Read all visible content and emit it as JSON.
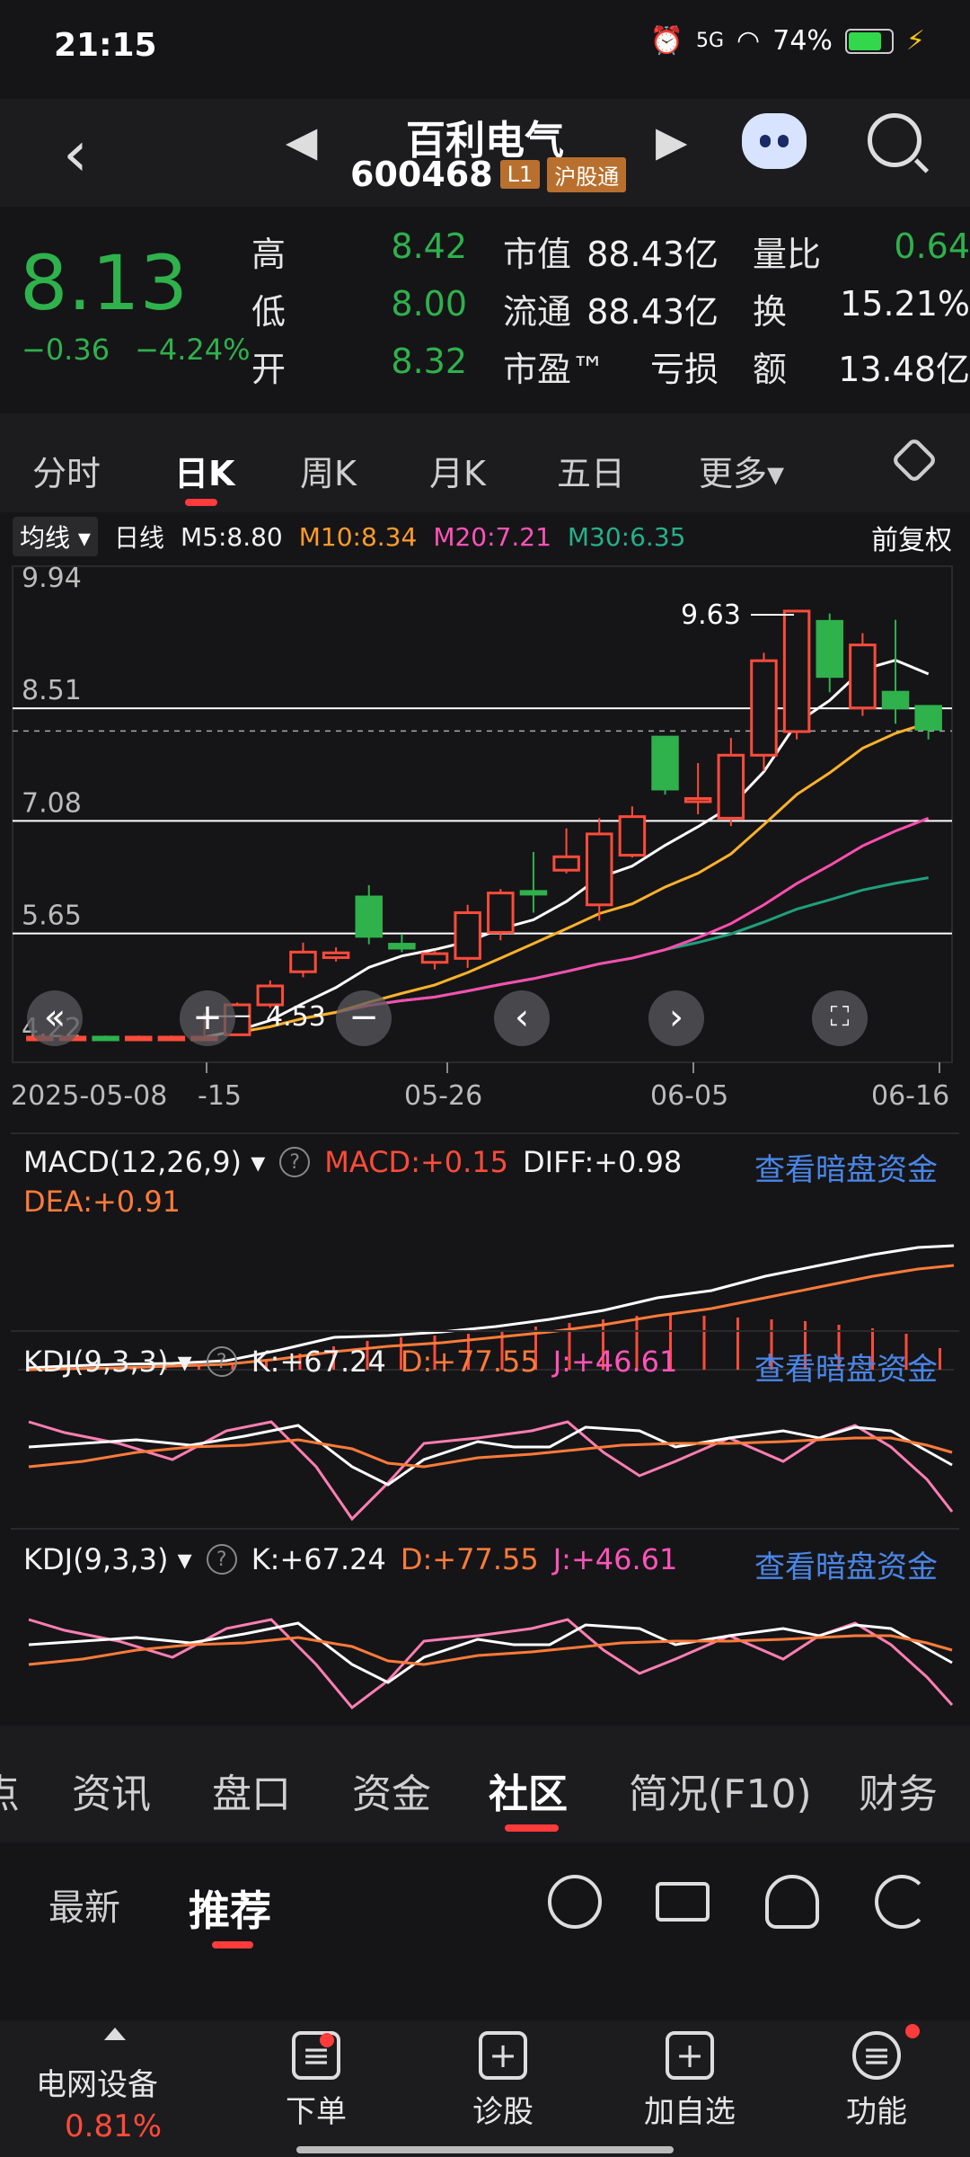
{
  "status": {
    "time": "21:15",
    "network": "5G",
    "battery": "74%"
  },
  "header": {
    "name": "百利电气",
    "code": "600468",
    "tag_level": "L1",
    "tag_connect": "沪股通"
  },
  "quote": {
    "price": "8.13",
    "change": "−0.36",
    "change_pct": "−4.24%",
    "high_label": "高",
    "high": "8.42",
    "low_label": "低",
    "low": "8.00",
    "open_label": "开",
    "open": "8.32",
    "mcap_label": "市值",
    "mcap": "88.43亿",
    "float_label": "流通",
    "float": "88.43亿",
    "pe_label": "市盈™",
    "pe": "亏损",
    "ratio_label": "量比",
    "ratio": "0.64",
    "turnover_label": "换",
    "turnover": "15.21%",
    "amount_label": "额",
    "amount": "13.48亿"
  },
  "ktabs": [
    "分时",
    "日K",
    "周K",
    "月K",
    "五日",
    "更多▾"
  ],
  "ma_legend": {
    "selector": "均线 ▾",
    "period": "日线",
    "m5": "M5:8.80",
    "m10": "M10:8.34",
    "m20": "M20:7.21",
    "m30": "M30:6.35",
    "adjust": "前复权"
  },
  "chart_data": {
    "type": "candlestick",
    "y_ticks": [
      "9.94",
      "8.51",
      "7.08",
      "5.65",
      "4.22"
    ],
    "x_ticks": [
      "2025-05-08",
      "-15",
      "05-26",
      "06-05",
      "06-16"
    ],
    "max_label": "9.63",
    "min_label": "4.53",
    "candles": [
      {
        "o": 4.22,
        "c": 4.22,
        "h": 4.25,
        "l": 4.2,
        "up": true
      },
      {
        "o": 4.22,
        "c": 4.22,
        "h": 4.24,
        "l": 4.2,
        "up": true
      },
      {
        "o": 4.22,
        "c": 4.22,
        "h": 4.24,
        "l": 4.2,
        "up": false
      },
      {
        "o": 4.22,
        "c": 4.22,
        "h": 4.24,
        "l": 4.2,
        "up": true
      },
      {
        "o": 4.22,
        "c": 4.22,
        "h": 4.24,
        "l": 4.2,
        "up": true
      },
      {
        "o": 4.22,
        "c": 4.22,
        "h": 4.24,
        "l": 4.53,
        "up": true
      },
      {
        "o": 4.25,
        "c": 4.63,
        "h": 4.66,
        "l": 4.53,
        "up": true
      },
      {
        "o": 4.63,
        "c": 4.87,
        "h": 4.94,
        "l": 4.59,
        "up": true
      },
      {
        "o": 5.05,
        "c": 5.3,
        "h": 5.42,
        "l": 4.98,
        "up": true
      },
      {
        "o": 5.29,
        "c": 5.23,
        "h": 5.36,
        "l": 5.18,
        "up": true
      },
      {
        "o": 6.0,
        "c": 5.5,
        "h": 6.15,
        "l": 5.4,
        "up": false
      },
      {
        "o": 5.4,
        "c": 5.35,
        "h": 5.53,
        "l": 5.3,
        "up": false
      },
      {
        "o": 5.17,
        "c": 5.28,
        "h": 5.32,
        "l": 5.08,
        "up": true
      },
      {
        "o": 5.22,
        "c": 5.8,
        "h": 5.9,
        "l": 5.1,
        "up": true
      },
      {
        "o": 5.55,
        "c": 6.05,
        "h": 6.1,
        "l": 5.45,
        "up": true
      },
      {
        "o": 6.07,
        "c": 6.07,
        "h": 6.57,
        "l": 5.8,
        "up": false
      },
      {
        "o": 6.34,
        "c": 6.51,
        "h": 6.87,
        "l": 6.3,
        "up": true
      },
      {
        "o": 5.9,
        "c": 6.8,
        "h": 7.0,
        "l": 5.7,
        "up": true
      },
      {
        "o": 7.02,
        "c": 6.53,
        "h": 7.15,
        "l": 6.5,
        "up": true
      },
      {
        "o": 8.03,
        "c": 7.37,
        "h": 8.04,
        "l": 7.3,
        "up": false
      },
      {
        "o": 7.21,
        "c": 7.25,
        "h": 7.7,
        "l": 7.05,
        "up": true
      },
      {
        "o": 7.0,
        "c": 7.8,
        "h": 8.02,
        "l": 6.9,
        "up": true
      },
      {
        "o": 7.8,
        "c": 9.0,
        "h": 9.1,
        "l": 7.6,
        "up": true
      },
      {
        "o": 8.1,
        "c": 9.63,
        "h": 9.63,
        "l": 8.0,
        "up": true
      },
      {
        "o": 9.5,
        "c": 8.8,
        "h": 9.6,
        "l": 8.6,
        "up": false
      },
      {
        "o": 8.4,
        "c": 9.2,
        "h": 9.35,
        "l": 8.3,
        "up": true
      },
      {
        "o": 8.6,
        "c": 8.4,
        "h": 9.52,
        "l": 8.2,
        "up": false
      },
      {
        "o": 8.42,
        "c": 8.13,
        "h": 8.4,
        "l": 8.0,
        "up": false
      }
    ]
  },
  "macd": {
    "title": "MACD(12,26,9) ▾",
    "macd": "MACD:+0.15",
    "diff": "DIFF:+0.98",
    "dea": "DEA:+0.91",
    "link": "查看暗盘资金"
  },
  "kdj1": {
    "title": "KDJ(9,3,3) ▾",
    "k": "K:+67.24",
    "d": "D:+77.55",
    "j": "J:+46.61",
    "link": "查看暗盘资金"
  },
  "kdj2": {
    "title": "KDJ(9,3,3) ▾",
    "k": "K:+67.24",
    "d": "D:+77.55",
    "j": "J:+46.61",
    "link": "查看暗盘资金"
  },
  "info_tabs": [
    "点",
    "资讯",
    "盘口",
    "资金",
    "社区",
    "简况(F10)",
    "财务"
  ],
  "sub_tabs": [
    "最新",
    "推荐"
  ],
  "bottom_nav": {
    "sector": "电网设备",
    "sector_pct": "0.81%",
    "items": [
      "下单",
      "诊股",
      "加自选",
      "功能"
    ]
  }
}
